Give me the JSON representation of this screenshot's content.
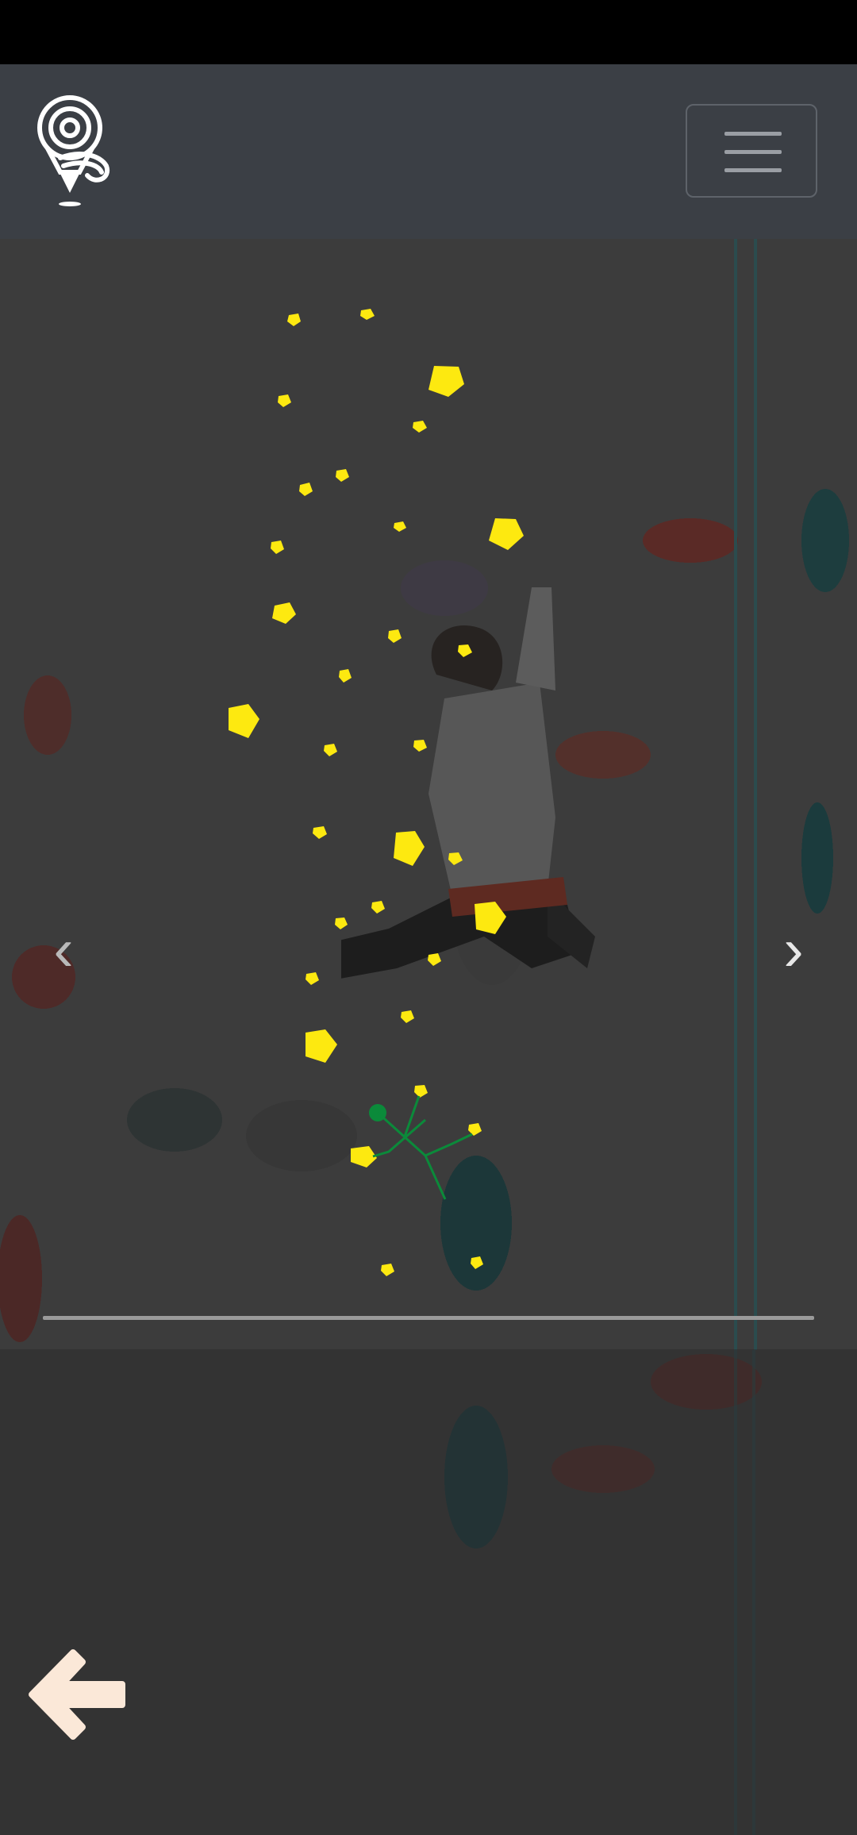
{
  "app": {
    "logo_icon": "lightbulb-rope-logo-icon",
    "menu_icon": "hamburger-menu-icon"
  },
  "carousel": {
    "prev_icon": "chevron-left-icon",
    "next_icon": "chevron-right-icon",
    "prev_glyph": "‹",
    "next_glyph": "›",
    "active_slide": 1,
    "slide_count": 1
  },
  "route": {
    "hold_color": "#fde910",
    "start_marker_color": "#0b8a3a"
  },
  "footer": {
    "back_icon": "arrow-left-icon",
    "back_color": "#fbe8d8"
  }
}
